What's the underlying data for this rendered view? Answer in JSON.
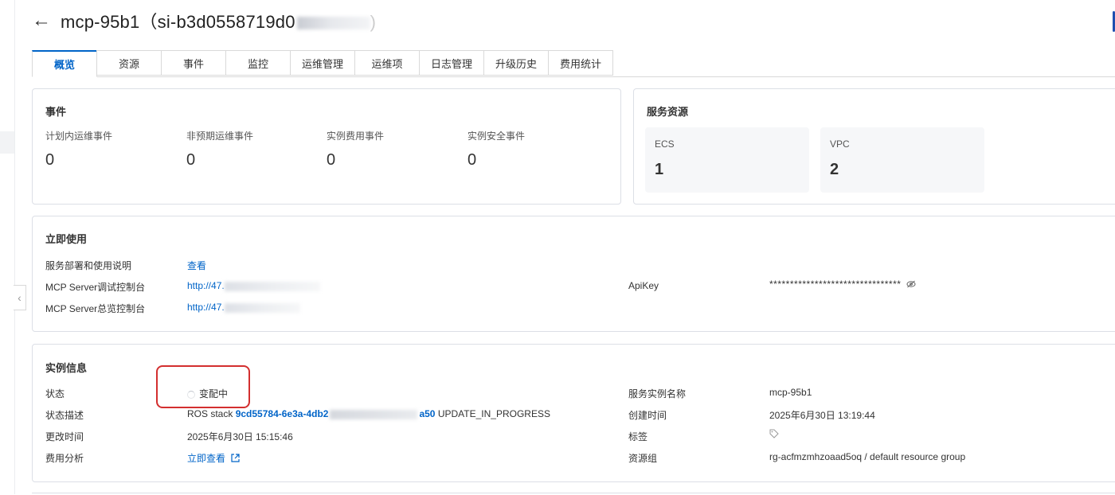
{
  "header": {
    "back_icon": "arrow-left-icon",
    "title_visible": "mcp-95b1（si-b3d0558719d0"
  },
  "tabs": [
    {
      "label": "概览",
      "active": true
    },
    {
      "label": "资源"
    },
    {
      "label": "事件"
    },
    {
      "label": "监控"
    },
    {
      "label": "运维管理"
    },
    {
      "label": "运维项"
    },
    {
      "label": "日志管理"
    },
    {
      "label": "升级历史"
    },
    {
      "label": "费用统计"
    }
  ],
  "events": {
    "title": "事件",
    "items": [
      {
        "label": "计划内运维事件",
        "value": "0"
      },
      {
        "label": "非预期运维事件",
        "value": "0"
      },
      {
        "label": "实例费用事件",
        "value": "0"
      },
      {
        "label": "实例安全事件",
        "value": "0"
      }
    ]
  },
  "service_resources": {
    "title": "服务资源",
    "items": [
      {
        "label": "ECS",
        "value": "1"
      },
      {
        "label": "VPC",
        "value": "2"
      }
    ]
  },
  "use_now": {
    "title": "立即使用",
    "deploy_label": "服务部署和使用说明",
    "deploy_link": "查看",
    "debug_console_label": "MCP Server调试控制台",
    "debug_console_url": "http://47.",
    "overview_console_label": "MCP Server总览控制台",
    "overview_console_url": "http://47.",
    "apikey_label": "ApiKey",
    "apikey_value": "********************************",
    "apikey_icon": "eye-off-icon"
  },
  "instance_info": {
    "title": "实例信息",
    "status_label": "状态",
    "status_value": "变配中",
    "status_desc_label": "状态描述",
    "status_desc_prefix": "ROS stack",
    "status_desc_stack_start": "9cd55784-6e3a-4db2",
    "status_desc_stack_end": "a50",
    "status_desc_suffix": "UPDATE_IN_PROGRESS",
    "modified_label": "更改时间",
    "modified_value": "2025年6月30日 15:15:46",
    "cost_label": "费用分析",
    "cost_link": "立即查看",
    "external_icon": "external-link-icon",
    "instance_name_label": "服务实例名称",
    "instance_name_value": "mcp-95b1",
    "created_label": "创建时间",
    "created_value": "2025年6月30日 13:19:44",
    "tags_label": "标签",
    "tag_icon": "tag-icon",
    "resource_group_label": "资源组",
    "resource_group_value": "rg-acfmzmhzoaad5oq / default resource group"
  },
  "colors": {
    "accent": "#0064c8",
    "highlight": "#d32f2f"
  }
}
